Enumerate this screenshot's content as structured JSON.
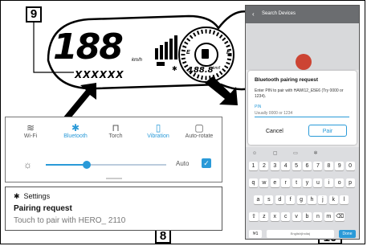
{
  "callouts": {
    "nine": "9",
    "eight": "8",
    "ten": "10"
  },
  "meter": {
    "speed_digits": "188",
    "unit_kmh": "km/h",
    "odo_placeholder": "XXXXXX",
    "trip_digits": "188.8",
    "unit_kml": "km/l",
    "fuel_e": "E",
    "fuel_f": "F",
    "gear_glyph": "P"
  },
  "quick_settings": {
    "items": [
      {
        "icon": "wifi-icon",
        "glyph": "≋",
        "label": "Wi-Fi",
        "active": false
      },
      {
        "icon": "bluetooth-icon",
        "glyph": "✱",
        "label": "Bluetooth",
        "active": true
      },
      {
        "icon": "torch-icon",
        "glyph": "⊓",
        "label": "Torch",
        "active": false
      },
      {
        "icon": "vibration-icon",
        "glyph": "▯",
        "label": "Vibration",
        "active": true
      },
      {
        "icon": "auto-rotate-icon",
        "glyph": "▢",
        "label": "Auto-rotate",
        "active": false
      }
    ],
    "brightness_auto": "Auto",
    "brightness_level": 0.34
  },
  "notification": {
    "app": "Settings",
    "title": "Pairing request",
    "body": "Touch to pair with HERO_ 2110"
  },
  "phone": {
    "header": "Search Devices",
    "dialog_title": "Bluetooth pairing request",
    "dialog_text": "Enter PIN to pair with HAWI12_E5E6 (Try 0000 or 1234).",
    "pin_label": "PIN",
    "pin_placeholder": "Usually 0000 or 1234",
    "cancel": "Cancel",
    "pair": "Pair",
    "keyboard_rows": [
      [
        "1",
        "2",
        "3",
        "4",
        "5",
        "6",
        "7",
        "8",
        "9",
        "0"
      ],
      [
        "q",
        "w",
        "e",
        "r",
        "t",
        "y",
        "u",
        "i",
        "o",
        "p"
      ],
      [
        "a",
        "s",
        "d",
        "f",
        "g",
        "h",
        "j",
        "k",
        "l"
      ],
      [
        "⇧",
        "z",
        "x",
        "c",
        "v",
        "b",
        "n",
        "m",
        "⌫"
      ]
    ],
    "kb_bottom": [
      "!#1",
      "English(India)",
      "Done"
    ]
  },
  "colors": {
    "accent": "#2a9ad8",
    "ink": "#000000",
    "phone_bar": "#6b6d70"
  }
}
